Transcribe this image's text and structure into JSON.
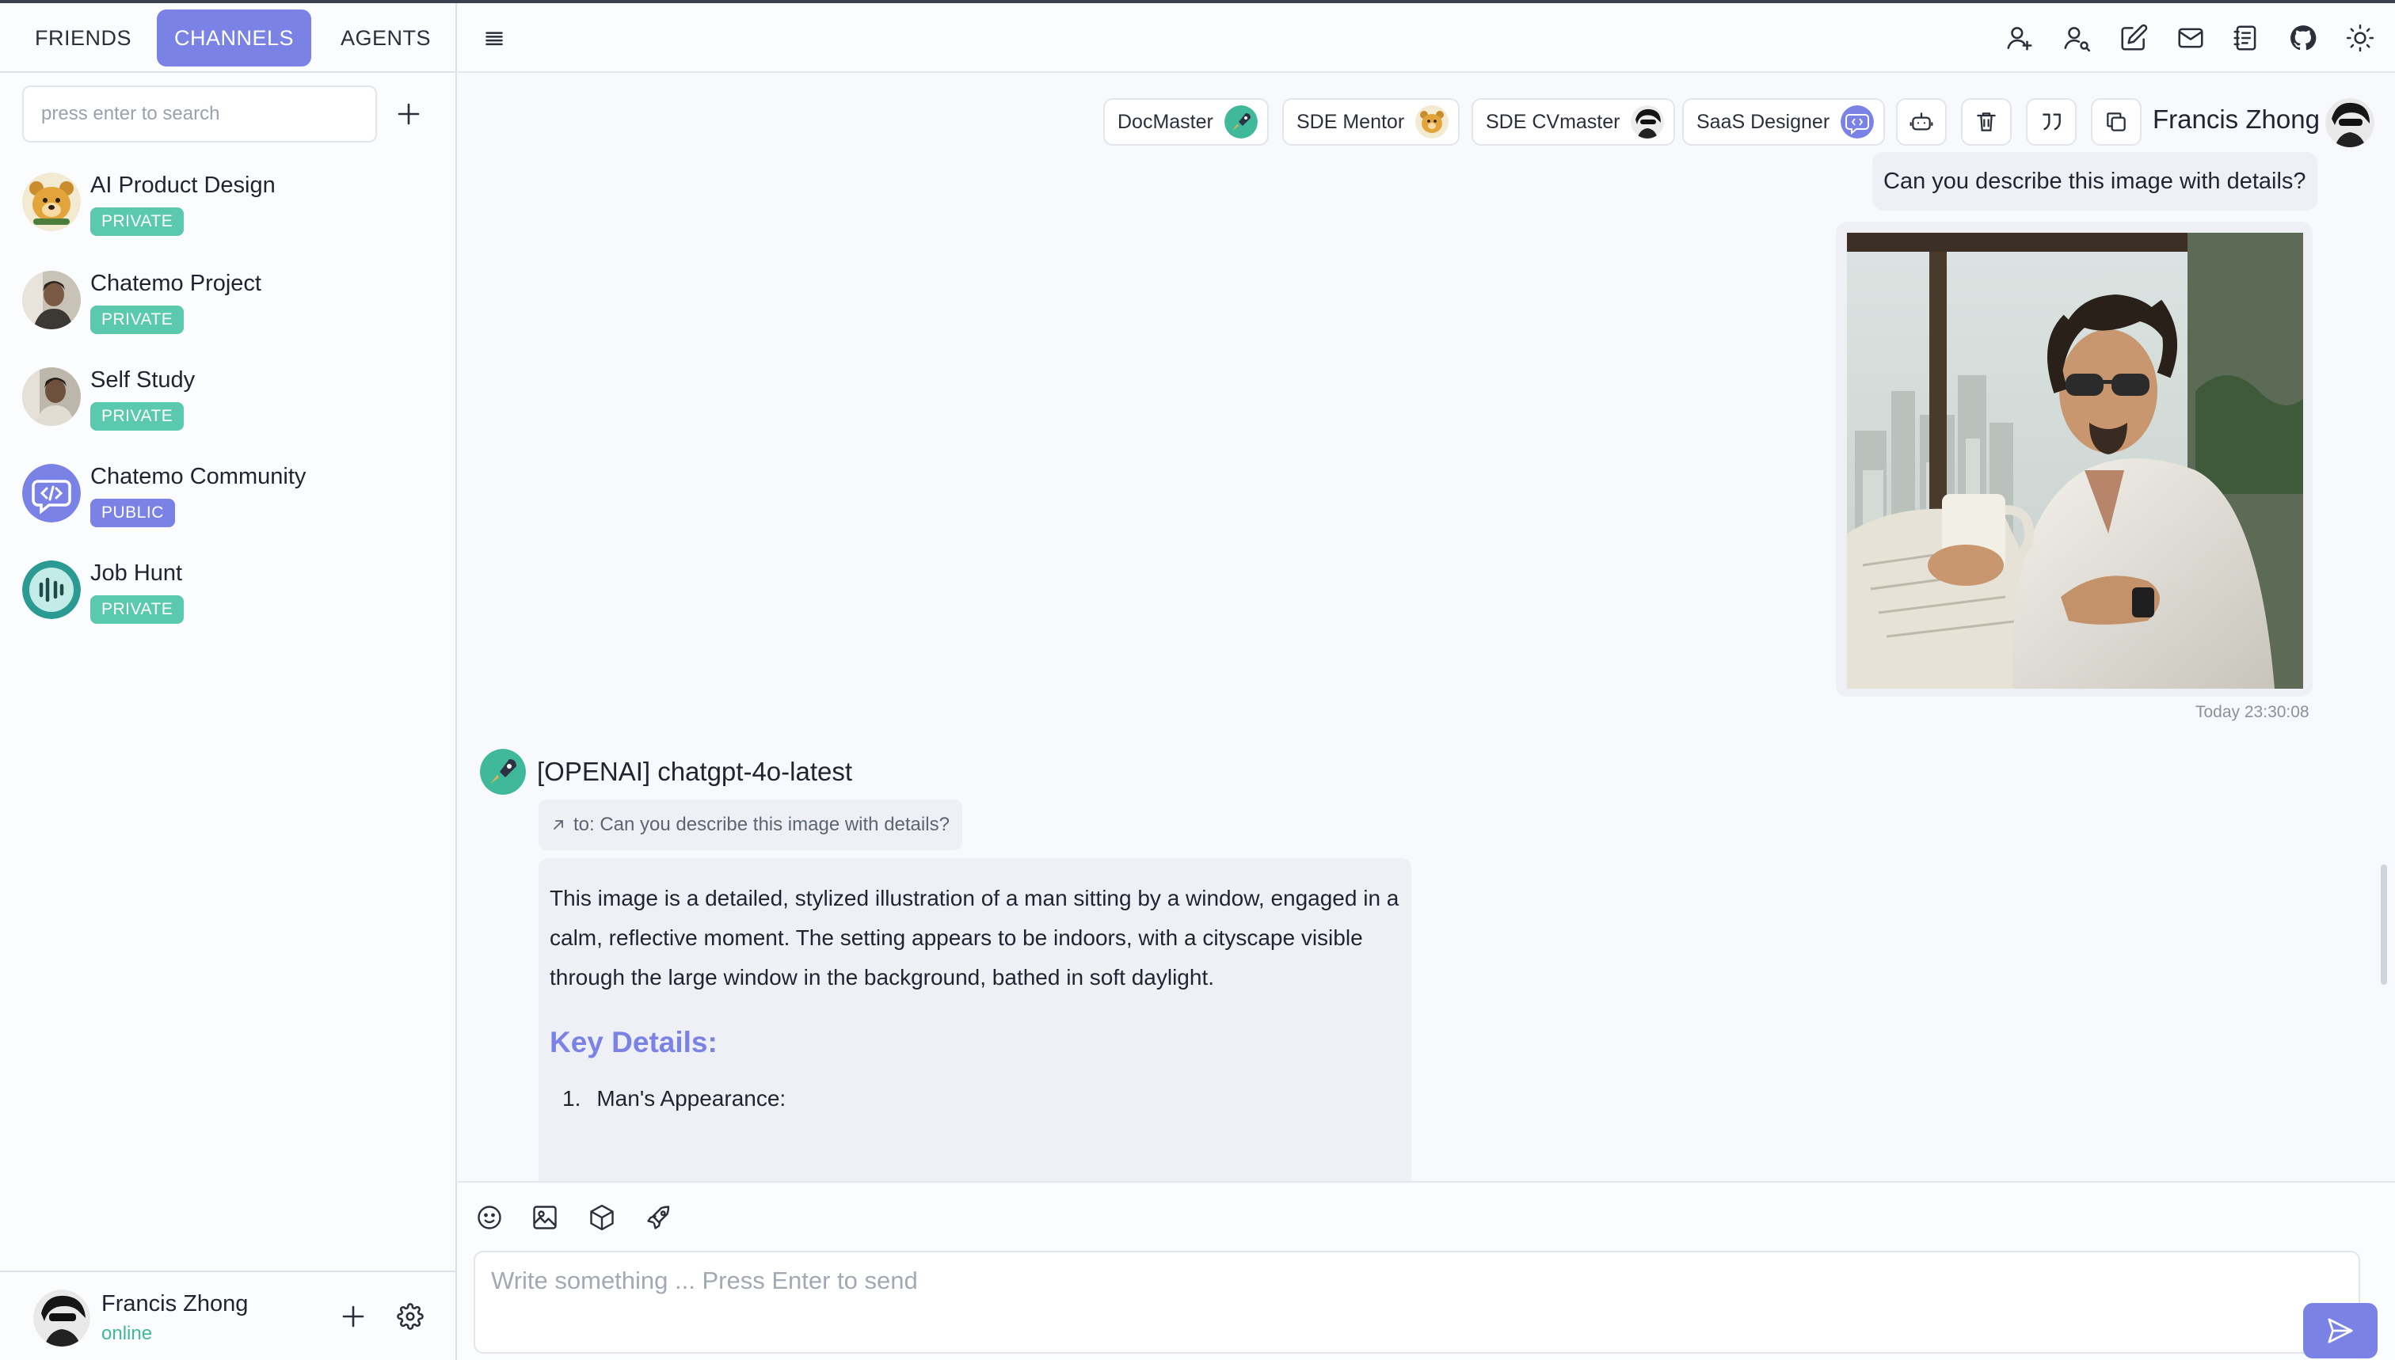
{
  "tabs": [
    {
      "label": "FRIENDS"
    },
    {
      "label": "CHANNELS",
      "active": true
    },
    {
      "label": "AGENTS"
    }
  ],
  "search": {
    "placeholder": "press enter to search"
  },
  "channels": [
    {
      "name": "AI Product Design",
      "badge": "PRIVATE"
    },
    {
      "name": "Chatemo Project",
      "badge": "PRIVATE"
    },
    {
      "name": "Self Study",
      "badge": "PRIVATE"
    },
    {
      "name": "Chatemo Community",
      "badge": "PUBLIC"
    },
    {
      "name": "Job Hunt",
      "badge": "PRIVATE"
    }
  ],
  "current_user": {
    "name": "Francis Zhong",
    "status": "online"
  },
  "agents_bar": [
    {
      "name": "DocMaster"
    },
    {
      "name": "SDE Mentor"
    },
    {
      "name": "SDE CVmaster"
    },
    {
      "name": "SaaS Designer"
    }
  ],
  "header": {
    "user_name": "Francis Zhong"
  },
  "conversation": {
    "user_message": "Can you describe this image with details?",
    "timestamp": "Today 23:30:08",
    "bot_name": "[OPENAI] chatgpt-4o-latest",
    "reply_to": "to: Can you describe this image with details?",
    "reply_paragraph": "This image is a detailed, stylized illustration of a man sitting by a window, engaged in a calm, reflective moment. The setting appears to be indoors, with a cityscape visible through the large window in the background, bathed in soft daylight.",
    "reply_heading": "Key Details:",
    "reply_list": [
      {
        "num": "1.",
        "text": "Man's Appearance:"
      }
    ]
  },
  "composer": {
    "placeholder": "Write something ... Press Enter to send"
  },
  "colors": {
    "accent": "#7a82e6",
    "private_badge": "#5ac9ad",
    "online": "#3fb99a"
  }
}
